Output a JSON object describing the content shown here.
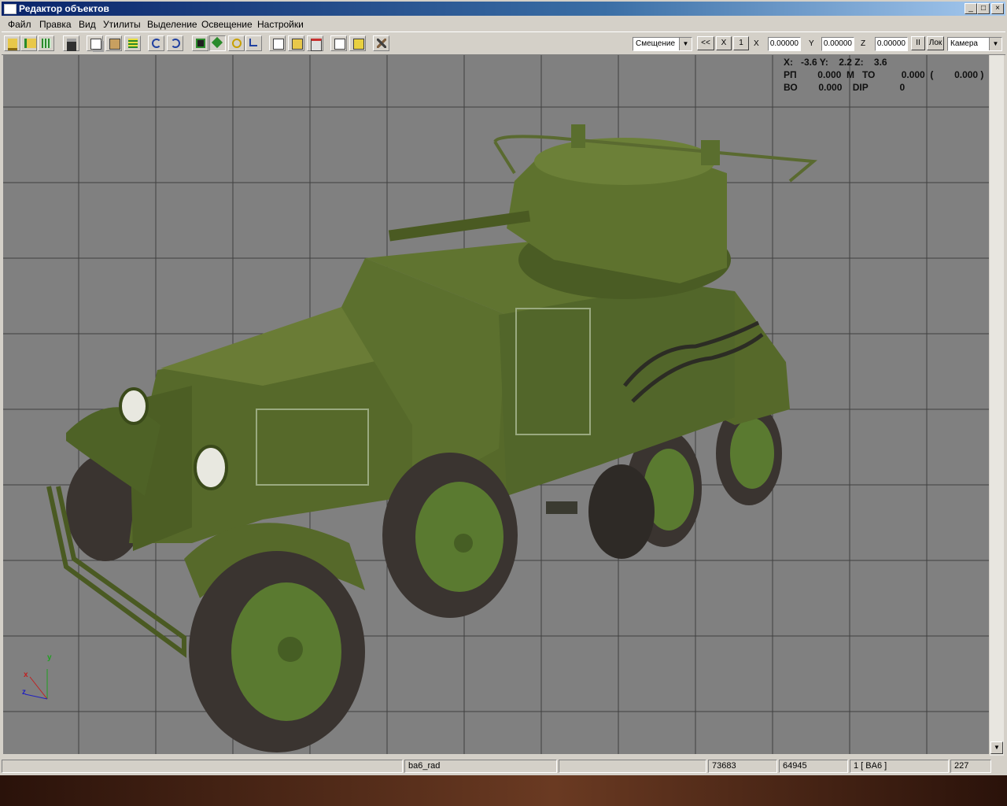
{
  "window": {
    "title": "Редактор объектов",
    "min_glyph": "_",
    "max_glyph": "□",
    "close_glyph": "×"
  },
  "menu": [
    "Файл",
    "Правка",
    "Вид",
    "Утилиты",
    "Выделение",
    "Освещение",
    "Настройки"
  ],
  "toolbar": {
    "icons": [
      "open-folder-icon",
      "open-recent-icon",
      "grid-icon",
      "save-icon",
      "copy-icon",
      "paste-icon",
      "grid-select-icon",
      "undo-icon",
      "redo-icon",
      "select-icon",
      "move-icon",
      "rotate-icon",
      "scale-icon",
      "properties-icon",
      "folder-props-icon",
      "material-icon",
      "box-icon",
      "cube-icon",
      "tools-icon"
    ],
    "mode": "Смещение",
    "btn_prev": "<<",
    "btn_x": "X",
    "btn_1": "1",
    "x_label": "X",
    "x_value": "0.00000",
    "y_label": "Y",
    "y_value": "0.00000",
    "z_label": "Z",
    "z_value": "0.00000",
    "btn_pause": "II",
    "lock_label": "Лок",
    "view": "Камера"
  },
  "hud": {
    "line1": "X:   -3.6 Y:    2.2 Z:    3.6",
    "line2": "РП        0.000  М   ТО          0.000  (        0.000 )",
    "line3": "ВО        0.000    DIP            0"
  },
  "axes": {
    "x": "x",
    "y": "y",
    "z": "z"
  },
  "status": [
    "",
    "ba6_rad",
    "",
    "73683",
    "64945",
    "1 [ BA6 ]",
    "227"
  ],
  "scroll": {
    "down_glyph": "▼"
  },
  "colors": {
    "grid_bg": "#808080",
    "grid_line": "#404040",
    "hull": "#5a6e2e"
  }
}
